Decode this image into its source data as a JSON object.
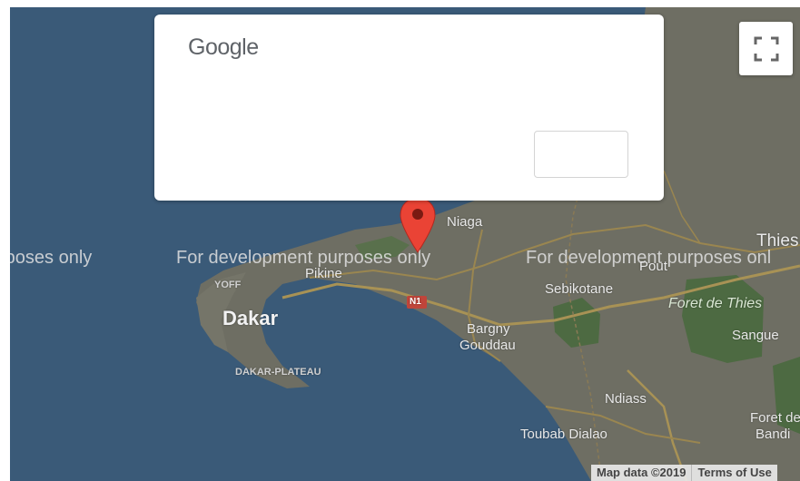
{
  "dialog": {
    "logo_text": "Google"
  },
  "watermark": {
    "text_left": "rposes only",
    "text_center": "For development purposes only",
    "text_right": "For development purposes onl"
  },
  "places": {
    "dakar": "Dakar",
    "yoff": "YOFF",
    "pikine": "Pikine",
    "dakar_plateau": "DAKAR-PLATEAU",
    "niaga": "Niaga",
    "sebikotane": "Sebikotane",
    "bargny": "Bargny",
    "gouddau": "Gouddau",
    "pout": "Pout",
    "thies": "Thies",
    "foret_de_thies": "Foret de Thies",
    "sangue": "Sangue",
    "ndiass": "Ndiass",
    "toubab_dialao": "Toubab Dialao",
    "foret_de": "Foret de",
    "bandi": "Bandi",
    "road_n1": "N1"
  },
  "attribution": {
    "map_data": "Map data ©2019",
    "terms": "Terms of Use"
  },
  "icons": {
    "fullscreen": "fullscreen-icon",
    "marker": "map-marker-icon"
  },
  "colors": {
    "water": "#3a5a78",
    "land": "#6e6e63",
    "forest": "#4d6a42",
    "road": "#a89255",
    "marker": "#ea4335"
  }
}
